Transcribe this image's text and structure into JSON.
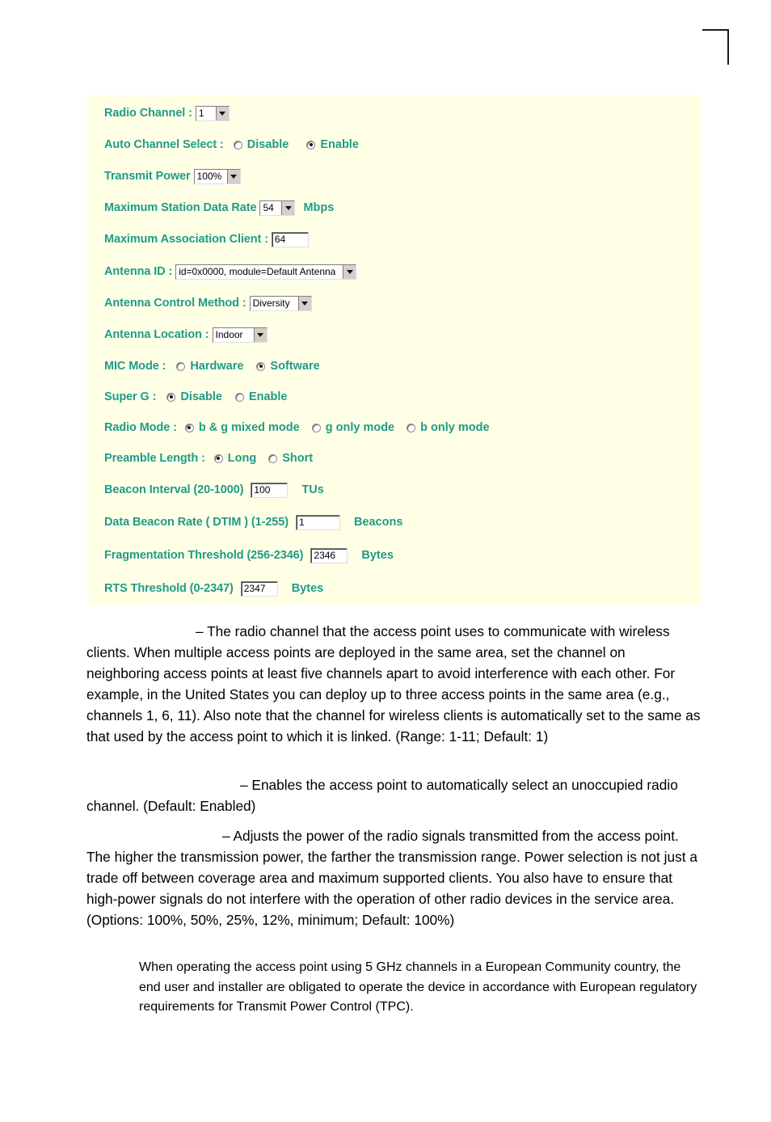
{
  "page": {
    "crop_mark": "corner-registration-mark"
  },
  "screenshot": {
    "panel_bg": "#ffffe6",
    "label_color": "#1f9b88",
    "rows": [
      {
        "id": "radio-channel",
        "label": "Radio Channel :",
        "control": "select",
        "value": "1"
      },
      {
        "id": "auto-channel-select",
        "label": "Auto Channel Select :",
        "control": "radio",
        "options": [
          {
            "label": "Disable",
            "checked": false
          },
          {
            "label": "Enable",
            "checked": true
          }
        ]
      },
      {
        "id": "transmit-power",
        "label": "Transmit Power",
        "control": "select",
        "value": "100%"
      },
      {
        "id": "maximum-station-data-rate",
        "label": "Maximum Station Data Rate",
        "control": "select",
        "value": "54",
        "unit": "Mbps"
      },
      {
        "id": "maximum-association-client",
        "label": "Maximum Association Client :",
        "control": "text",
        "value": "64"
      },
      {
        "id": "antenna-id",
        "label": "Antenna ID :",
        "control": "select",
        "value": "id=0x0000, module=Default Antenna"
      },
      {
        "id": "antenna-control-method",
        "label": "Antenna Control Method :",
        "control": "select",
        "value": "Diversity"
      },
      {
        "id": "antenna-location",
        "label": "Antenna Location :",
        "control": "select",
        "value": "Indoor"
      },
      {
        "id": "mic-mode",
        "label": "MIC Mode :",
        "control": "radio",
        "options": [
          {
            "label": "Hardware",
            "checked": false
          },
          {
            "label": "Software",
            "checked": true
          }
        ]
      },
      {
        "id": "super-g",
        "label": "Super G :",
        "control": "radio",
        "options": [
          {
            "label": "Disable",
            "checked": true
          },
          {
            "label": "Enable",
            "checked": false
          }
        ]
      },
      {
        "id": "radio-mode",
        "label": "Radio Mode :",
        "control": "radio",
        "options": [
          {
            "label": "b & g mixed mode",
            "checked": true
          },
          {
            "label": "g only mode",
            "checked": false
          },
          {
            "label": "b only mode",
            "checked": false
          }
        ]
      },
      {
        "id": "preamble-length",
        "label": "Preamble Length :",
        "control": "radio",
        "options": [
          {
            "label": "Long",
            "checked": true
          },
          {
            "label": "Short",
            "checked": false
          }
        ]
      },
      {
        "id": "beacon-interval",
        "label": "Beacon Interval (20-1000)",
        "control": "text",
        "value": "100",
        "unit": "TUs"
      },
      {
        "id": "data-beacon-rate",
        "label": "Data Beacon Rate ( DTIM ) (1-255)",
        "control": "text",
        "value": "1",
        "unit": "Beacons"
      },
      {
        "id": "fragmentation-threshold",
        "label": "Fragmentation Threshold (256-2346)",
        "control": "text",
        "value": "2346",
        "unit": "Bytes"
      },
      {
        "id": "rts-threshold",
        "label": "RTS Threshold (0-2347)",
        "control": "text",
        "value": "2347",
        "unit": "Bytes"
      }
    ]
  },
  "document": {
    "paragraphs": {
      "radio_channel": "– The radio channel that the access point uses to communicate with wireless clients. When multiple access points are deployed in the same area, set the channel on neighboring access points at least five channels apart to avoid interference with each other. For example, in the United States you can deploy up to three access points in the same area (e.g., channels 1, 6, 11). Also note that the channel for wireless clients is automatically set to the same as that used by the access point to which it is linked. (Range: 1-11; Default: 1)",
      "auto_channel_select": "– Enables the access point to automatically select an unoccupied radio channel. (Default: Enabled)",
      "transmit_power": "– Adjusts the power of the radio signals transmitted from the access point. The higher the transmission power, the farther the transmission range. Power selection is not just a trade off between coverage area and maximum supported clients. You also have to ensure that high-power signals do not interfere with the operation of other radio devices in the service area. (Options: 100%, 50%, 25%, 12%, minimum; Default: 100%)",
      "note": "When operating the access point using 5 GHz channels in a European Community country, the end user and installer are obligated to operate the device in accordance with European regulatory requirements for Transmit Power Control (TPC)."
    }
  }
}
